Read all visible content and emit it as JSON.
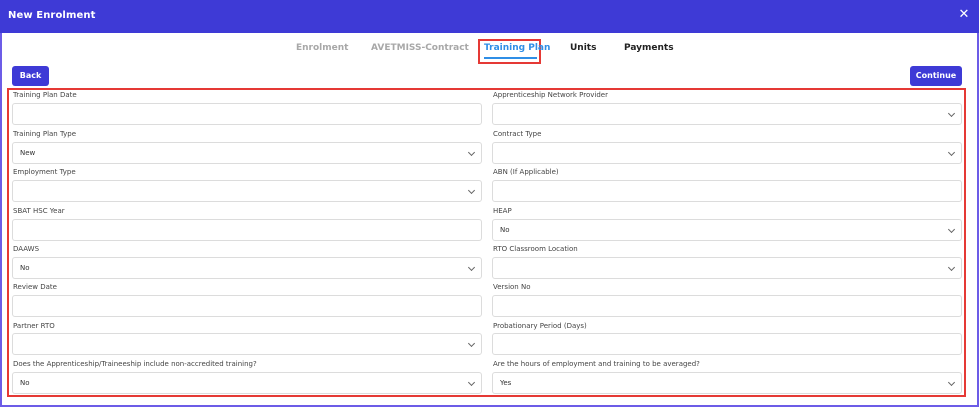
{
  "header": {
    "title": "New Enrolment",
    "close_icon": "close-icon"
  },
  "tabs": [
    {
      "label": "Enrolment"
    },
    {
      "label": "AVETMISS-Contract"
    },
    {
      "label": "Training Plan"
    },
    {
      "label": "Units"
    },
    {
      "label": "Payments"
    }
  ],
  "active_tab": "Training Plan",
  "buttons": {
    "back": "Back",
    "continue": "Continue"
  },
  "colors": {
    "header_bg": "#3e3ad6",
    "accent": "#2f8ee6",
    "highlight": "#e53935"
  },
  "form": {
    "left": [
      {
        "label": "Training Plan Date",
        "value": ""
      },
      {
        "label": "Training Plan Type",
        "value": "New"
      },
      {
        "label": "Employment Type",
        "value": ""
      },
      {
        "label": "SBAT HSC Year",
        "value": ""
      },
      {
        "label": "DAAWS",
        "value": "No"
      },
      {
        "label": "Review Date",
        "value": ""
      },
      {
        "label": "Partner RTO",
        "value": ""
      },
      {
        "label": "Does the Apprenticeship/Traineeship include non-accredited training?",
        "value": "No"
      }
    ],
    "right": [
      {
        "label": "Apprenticeship Network Provider",
        "value": ""
      },
      {
        "label": "Contract Type",
        "value": ""
      },
      {
        "label": "ABN (If Applicable)",
        "value": ""
      },
      {
        "label": "HEAP",
        "value": "No"
      },
      {
        "label": "RTO Classroom Location",
        "value": ""
      },
      {
        "label": "Version No",
        "value": ""
      },
      {
        "label": "Probationary Period (Days)",
        "value": ""
      },
      {
        "label": "Are the hours of employment and training to be averaged?",
        "value": "Yes"
      }
    ]
  }
}
